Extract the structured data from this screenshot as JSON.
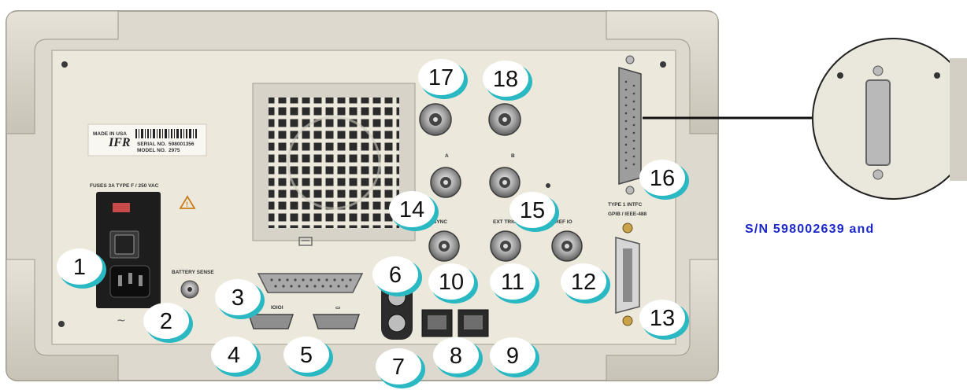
{
  "panel_labels": {
    "fuses": "FUSES 3A TYPE F / 250 VAC",
    "battery_sense": "BATTERY SENSE",
    "connector_a": "A",
    "connector_b": "B",
    "sync": "SYNC",
    "ext_trig": "EXT TRIG",
    "ref_io": "REF IO",
    "type1_intfc": "TYPE 1 INTFC",
    "gpib": "GPIB / IEEE-488",
    "made_in": "MADE IN USA",
    "brand": "IFR",
    "serial_label": "SERIAL NO.",
    "serial_value": "598001356",
    "model_label": "MODEL NO.",
    "model_value": "2975"
  },
  "callouts": [
    {
      "label": "1"
    },
    {
      "label": "2"
    },
    {
      "label": "3"
    },
    {
      "label": "4"
    },
    {
      "label": "5"
    },
    {
      "label": "6"
    },
    {
      "label": "7"
    },
    {
      "label": "8"
    },
    {
      "label": "9"
    },
    {
      "label": "10"
    },
    {
      "label": "11"
    },
    {
      "label": "12"
    },
    {
      "label": "13"
    },
    {
      "label": "14"
    },
    {
      "label": "15"
    },
    {
      "label": "16"
    },
    {
      "label": "17"
    },
    {
      "label": "18"
    }
  ],
  "caption": "S/N 598002639 and",
  "colors": {
    "callout_shadow": "#2ab8c2",
    "caption": "#1a27c9",
    "panel": "#ece8dc",
    "bumper": "#d9d5cb"
  }
}
